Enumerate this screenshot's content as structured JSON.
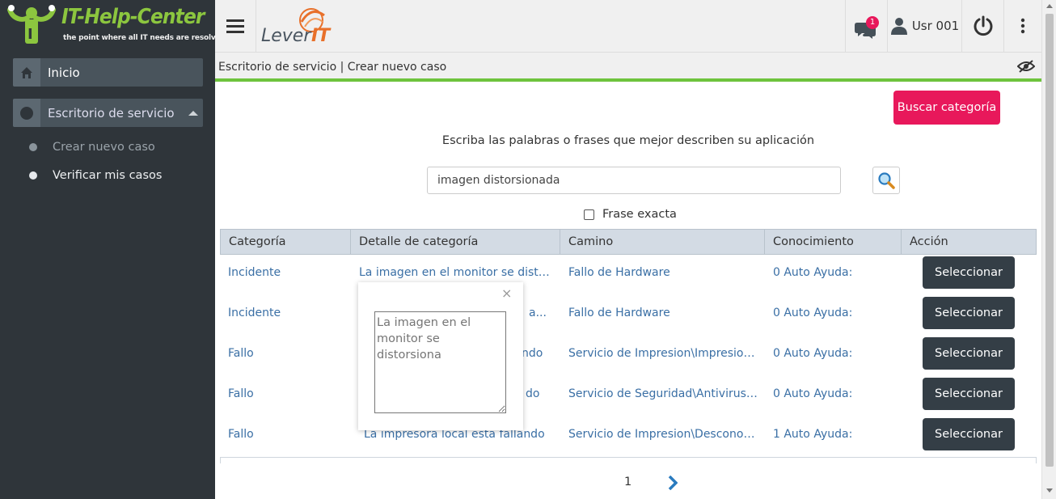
{
  "brand": {
    "title": "IT-Help-Center",
    "tagline": "the point where    all IT needs are resolved",
    "partner_logo_text": "LeverIT",
    "title_color": "#8cc63f"
  },
  "sidebar": {
    "home_label": "Inicio",
    "service_label": "Escritorio de servicio",
    "sub_items": [
      {
        "label": "Crear nuevo caso",
        "active": true
      },
      {
        "label": "Verificar mis casos",
        "active": false
      }
    ]
  },
  "topbar": {
    "notification_count": "1",
    "user_name": "Usr 001",
    "icons": [
      "menu-icon",
      "chat-icon",
      "user-icon",
      "power-icon",
      "more-vertical-icon"
    ]
  },
  "breadcrumb": {
    "text": "Escritorio de servicio | Crear nuevo caso",
    "accent_color": "#6ec33d"
  },
  "search": {
    "button_label": "Buscar categoría",
    "instruction": "Escriba las palabras o frases que mejor describen su aplicación",
    "query": "imagen distorsionada",
    "exact_label": "Frase exacta",
    "exact_checked": false,
    "button_color": "#e8185b"
  },
  "table": {
    "headers": [
      "Categoría",
      "Detalle de categoría",
      "Camino",
      "Conocimiento",
      "Acción"
    ],
    "rows": [
      {
        "categoria": "Incidente",
        "detalle": "La imagen en el monitor se distor...",
        "camino": "Fallo de Hardware",
        "conocimiento": "0 Auto Ayuda:",
        "accion": "Seleccionar"
      },
      {
        "categoria": "Incidente",
        "detalle": "a...",
        "camino": "Fallo de Hardware",
        "conocimiento": "0 Auto Ayuda:",
        "accion": "Seleccionar"
      },
      {
        "categoria": "Fallo",
        "detalle": "ndo",
        "camino": "Servicio de Impresion\\Impresion ...",
        "conocimiento": "0 Auto Ayuda:",
        "accion": "Seleccionar"
      },
      {
        "categoria": "Fallo",
        "detalle": "do",
        "camino": "Servicio de Seguridad\\Antivirus\\P...",
        "conocimiento": "0 Auto Ayuda:",
        "accion": "Seleccionar"
      },
      {
        "categoria": "Fallo",
        "detalle": "La impresora local esta fallando",
        "camino": "Servicio de Impresion\\Desconocido",
        "conocimiento": "1 Auto Ayuda:",
        "accion": "Seleccionar"
      }
    ]
  },
  "pagination": {
    "current_page": "1"
  },
  "popover": {
    "close_symbol": "×",
    "placeholder": "La imagen en el monitor se distorsiona"
  }
}
